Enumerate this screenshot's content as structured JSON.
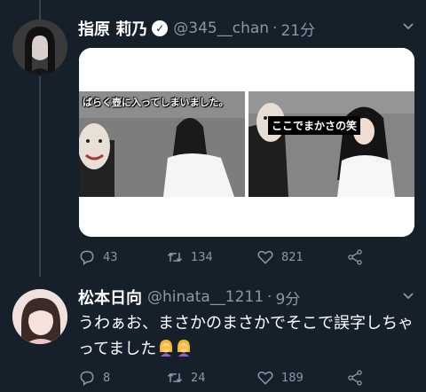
{
  "tweet1": {
    "display_name": "指原 莉乃",
    "handle": "@345__chan",
    "time": "21分",
    "media": {
      "left_caption": "ばらく壺に入ってしまいました。",
      "right_caption": "ここでまかさの笑"
    },
    "actions": {
      "replies": "43",
      "retweets": "134",
      "likes": "821"
    }
  },
  "tweet2": {
    "display_name": "松本日向",
    "handle": "@hinata__1211",
    "time": "9分",
    "text": "うわぁお、まさかのまさかでそこで誤字しちゃってました",
    "emojis": [
      "woman-facepalming-emoji",
      "woman-facepalming-emoji"
    ],
    "actions": {
      "replies": "8",
      "retweets": "24",
      "likes": "189"
    }
  },
  "colors": {
    "background": "#15202b",
    "secondary_text": "#8899a6",
    "divider": "#38444d"
  }
}
